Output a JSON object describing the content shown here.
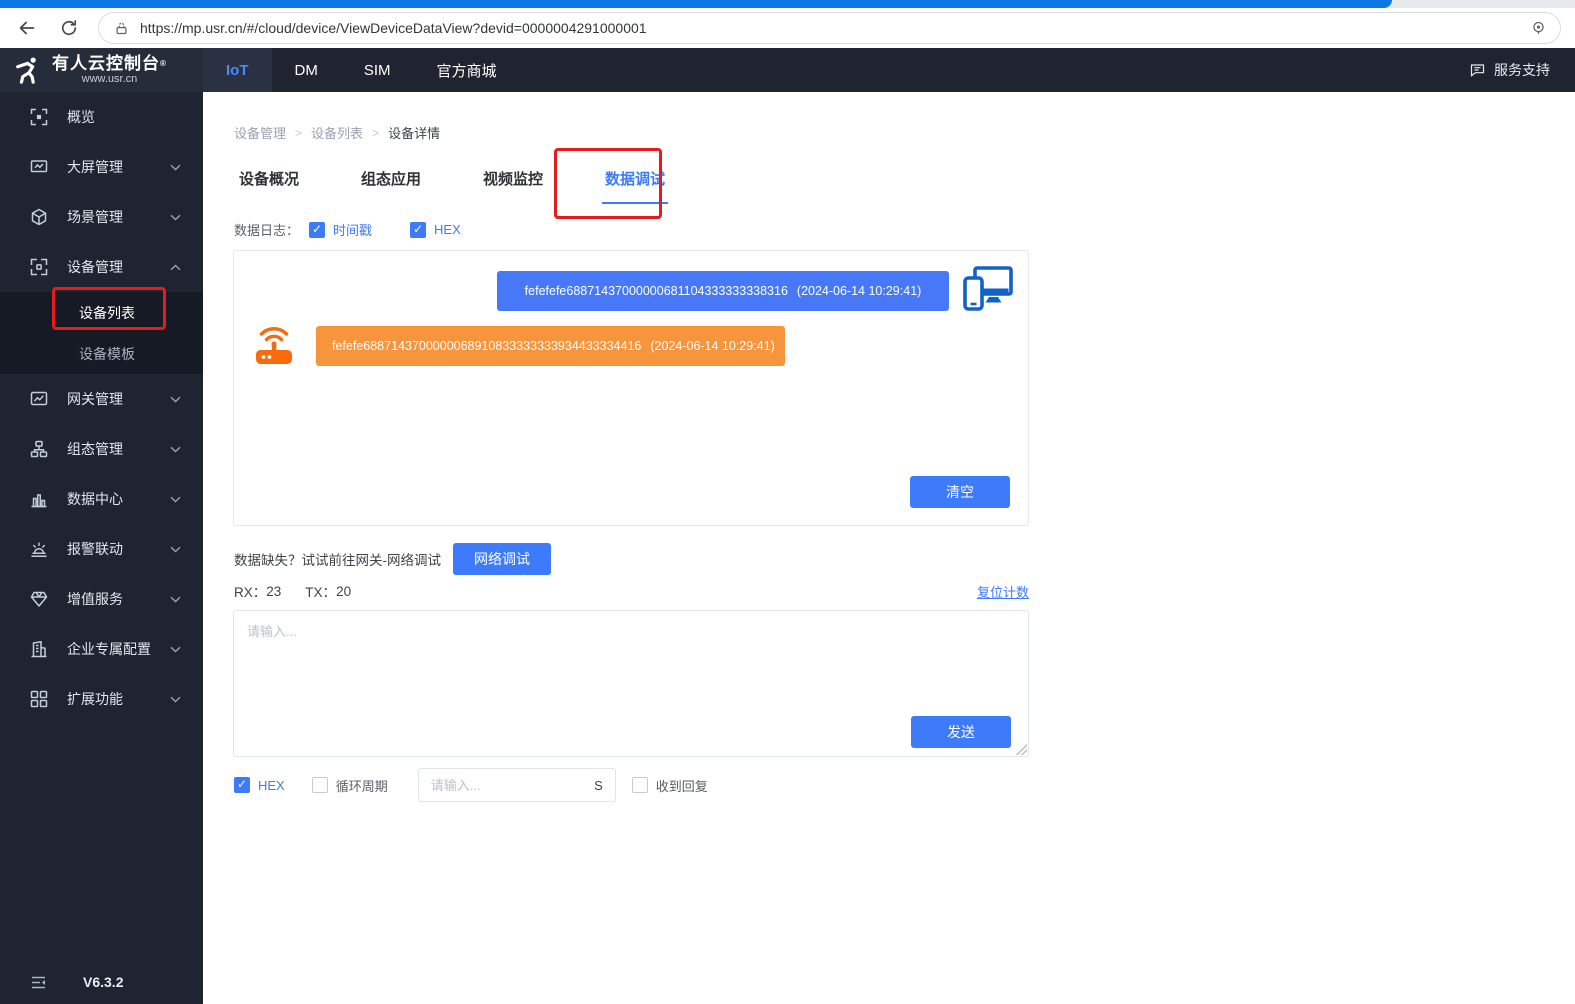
{
  "browser": {
    "url": "https://mp.usr.cn/#/cloud/device/ViewDeviceDataView?devid=0000004291000001"
  },
  "header": {
    "logo_title": "有人云控制台",
    "logo_mark": "®",
    "logo_subtitle": "www.usr.cn",
    "nav": [
      {
        "label": "IoT",
        "active": true
      },
      {
        "label": "DM",
        "active": false
      },
      {
        "label": "SIM",
        "active": false
      },
      {
        "label": "官方商城",
        "active": false
      }
    ],
    "support_label": "服务支持",
    "support_icon": "chat-icon"
  },
  "sidebar": {
    "items": [
      {
        "label": "概览",
        "icon": "overview-icon",
        "chevron": ""
      },
      {
        "label": "大屏管理",
        "icon": "big-screen-icon",
        "chevron": "down"
      },
      {
        "label": "场景管理",
        "icon": "scene-icon",
        "chevron": "down"
      },
      {
        "label": "设备管理",
        "icon": "device-icon",
        "chevron": "up",
        "expanded": true,
        "children": [
          {
            "label": "设备列表",
            "active": true,
            "annotated": true
          },
          {
            "label": "设备模板",
            "active": false
          }
        ]
      },
      {
        "label": "网关管理",
        "icon": "gateway-icon",
        "chevron": "down"
      },
      {
        "label": "组态管理",
        "icon": "configuration-icon",
        "chevron": "down"
      },
      {
        "label": "数据中心",
        "icon": "data-center-icon",
        "chevron": "down"
      },
      {
        "label": "报警联动",
        "icon": "alarm-icon",
        "chevron": "down"
      },
      {
        "label": "增值服务",
        "icon": "value-added-icon",
        "chevron": "down"
      },
      {
        "label": "企业专属配置",
        "icon": "enterprise-icon",
        "chevron": "down"
      },
      {
        "label": "扩展功能",
        "icon": "extension-icon",
        "chevron": "down"
      }
    ],
    "version": "V6.3.2"
  },
  "main": {
    "breadcrumb": {
      "items": [
        "设备管理",
        "设备列表",
        "设备详情"
      ],
      "separator": ">"
    },
    "tabs": [
      {
        "label": "设备概况",
        "active": false
      },
      {
        "label": "组态应用",
        "active": false
      },
      {
        "label": "视频监控",
        "active": false
      },
      {
        "label": "数据调试",
        "active": true
      }
    ],
    "datalog": {
      "label": "数据日志：",
      "timestamp_label": "时间戳",
      "timestamp_checked": true,
      "hex_label": "HEX",
      "hex_checked": true
    },
    "messages": [
      {
        "direction": "sent",
        "hex": "fefefefe68871437000000681104333333338316",
        "time": "(2024-06-14 10:29:41)",
        "icon": "devices-icon"
      },
      {
        "direction": "received",
        "hex": "fefefe6887143700000068910833333333934433334416",
        "time": "(2024-06-14 10:29:41)",
        "icon": "router-icon"
      }
    ],
    "clear_button": "清空",
    "hint_text": "数据缺失？试试前往网关-网络调试",
    "network_debug_button": "网络调试",
    "counters": {
      "rx_label": "RX：",
      "rx_value": "23",
      "tx_label": "TX：",
      "tx_value": "20",
      "reset_link": "复位计数"
    },
    "compose": {
      "placeholder": "请输入...",
      "send_button": "发送"
    },
    "options": {
      "hex_label": "HEX",
      "hex_checked": true,
      "cycle_label": "循环周期",
      "cycle_checked": false,
      "cycle_placeholder": "请输入...",
      "cycle_unit": "S",
      "reply_label": "收到回复",
      "reply_checked": false
    }
  },
  "colors": {
    "accent_blue": "#3D7BFA",
    "sent_bubble": "#4678F8",
    "received_bubble": "#F7953D",
    "devices_icon_blue": "#1062C8",
    "router_icon_orange": "#F96A0D",
    "annotation_red": "#E51C1C",
    "header_dark": "#1F2430"
  }
}
